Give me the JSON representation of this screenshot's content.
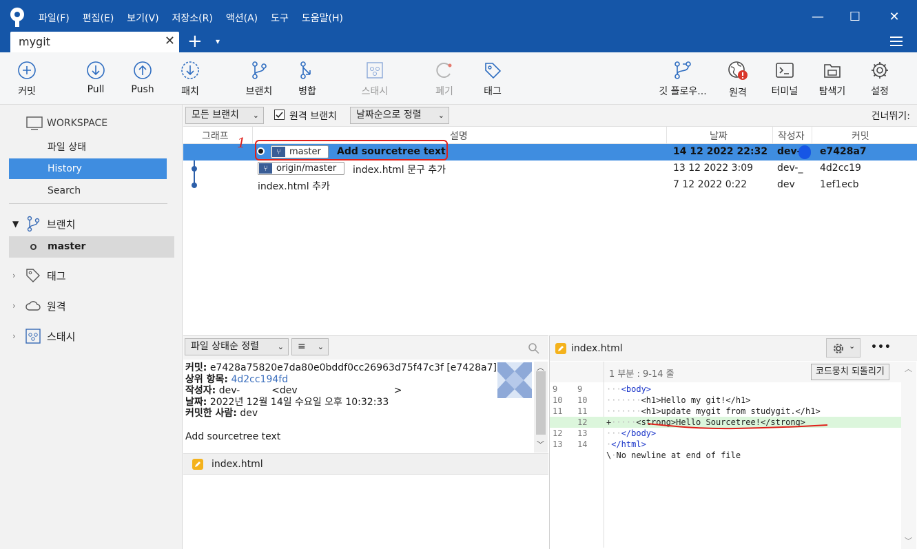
{
  "menu": [
    "파일(F)",
    "편집(E)",
    "보기(V)",
    "저장소(R)",
    "액션(A)",
    "도구",
    "도움말(H)"
  ],
  "window_controls": {
    "minimize": "—",
    "maximize": "☐",
    "close": "✕"
  },
  "tab": {
    "title": "mygit",
    "close": "✕",
    "plus": "+",
    "dropdown": "▾"
  },
  "toolbar": {
    "commit": "커밋",
    "pull": "Pull",
    "push": "Push",
    "patch": "패치",
    "branch": "브랜치",
    "merge": "병합",
    "stash": "스태시",
    "discard": "폐기",
    "tag": "태그",
    "gitflow": "깃 플로우...",
    "remote": "원격",
    "terminal": "터미널",
    "explorer": "탐색기",
    "settings": "설정"
  },
  "sidebar": {
    "workspace": "WORKSPACE",
    "items": [
      "파일 상태",
      "History",
      "Search"
    ],
    "branches": "브랜치",
    "current_branch": "master",
    "tags": "태그",
    "remotes": "원격",
    "stashes": "스태시"
  },
  "filter": {
    "branches_dropdown": "모든 브랜치",
    "remote_branches_label": "원격 브랜치",
    "remote_branches_checked": true,
    "sort_dropdown": "날짜순으로 정렬",
    "skip": "건너뛰기:"
  },
  "columns": {
    "graph": "그래프",
    "description": "설명",
    "date": "날짜",
    "author": "작성자",
    "commit": "커밋"
  },
  "annotation_mark": "1",
  "commits": [
    {
      "branch": "master",
      "message": "Add sourcetree text",
      "date": "14 12 2022 22:32",
      "author": "dev-",
      "hash": "e7428a7"
    },
    {
      "branch": "origin/master",
      "message": "index.html 문구 추가",
      "date": "13 12 2022 3:09",
      "author": "dev-_",
      "hash": "4d2cc19"
    },
    {
      "branch": "",
      "message": "index.html 추카",
      "date": "7 12 2022 0:22",
      "author": "dev",
      "hash": "1ef1ecb"
    }
  ],
  "lower": {
    "sort_dropdown": "파일 상태순 정렬",
    "view_dropdown": "≡",
    "details": {
      "commit_label": "커밋:",
      "commit_value": "e7428a75820e7da80e0bddf0cc26963d75f47c3f [e7428a7]",
      "parent_label": "상위 항목:",
      "parent_value": "4d2cc194fd",
      "author_label": "작성자:",
      "author_value": "dev-",
      "author_email": "<dev",
      "author_email_end": ">",
      "date_label": "날짜:",
      "date_value": "2022년 12월 14일 수요일 오후 10:32:33",
      "committer_label": "커밋한 사람:",
      "committer_value": "dev",
      "message": "Add sourcetree text"
    },
    "file": "index.html"
  },
  "diff": {
    "file": "index.html",
    "hunk": "1 부분 : 9-14 줄",
    "revert_button": "코드뭉치 되돌리기",
    "more": "•••",
    "lines": [
      {
        "old": "9",
        "new": "9",
        "type": "ctx",
        "text": "<body>"
      },
      {
        "old": "10",
        "new": "10",
        "type": "ctx",
        "text": "<h1>Hello my git!</h1>"
      },
      {
        "old": "11",
        "new": "11",
        "type": "ctx",
        "text": "<h1>update mygit from studygit.</h1>"
      },
      {
        "old": "",
        "new": "12",
        "type": "add",
        "text": "<strong>Hello Sourcetree!</strong>"
      },
      {
        "old": "12",
        "new": "13",
        "type": "ctx",
        "text": "</body>"
      },
      {
        "old": "13",
        "new": "14",
        "type": "ctx",
        "text": "</html>"
      },
      {
        "old": "",
        "new": "",
        "type": "ctx",
        "text": "No newline at end of file"
      }
    ]
  }
}
